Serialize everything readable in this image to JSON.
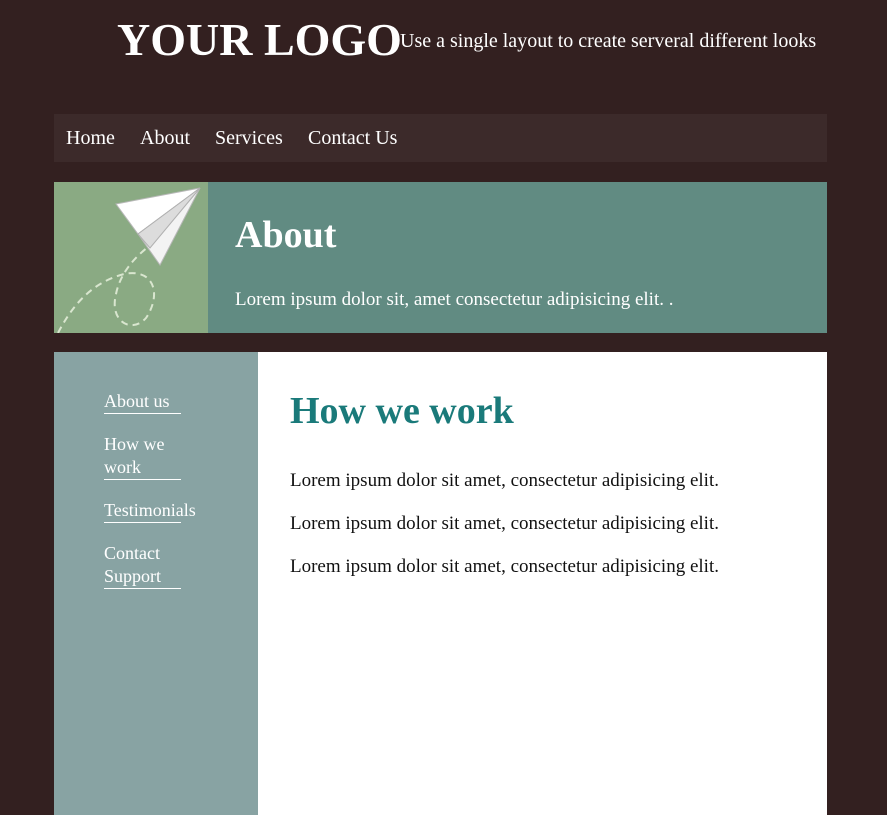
{
  "header": {
    "logo": "YOUR LOGO",
    "tagline": "Use a single layout to create serveral different looks"
  },
  "nav": {
    "items": [
      "Home",
      "About",
      "Services",
      "Contact Us"
    ]
  },
  "hero": {
    "image_icon": "paper-plane-icon",
    "title": "About",
    "text": "Lorem ipsum dolor sit, amet consectetur adipisicing elit. ."
  },
  "sidebar": {
    "links": [
      "About us",
      "How we work",
      "Testimonials",
      "Contact Support"
    ]
  },
  "main": {
    "title": "How we work",
    "paragraphs": [
      "Lorem ipsum dolor sit amet, consectetur adipisicing elit.",
      "Lorem ipsum dolor sit amet, consectetur adipisicing elit.",
      "Lorem ipsum dolor sit amet, consectetur adipisicing elit."
    ]
  },
  "colors": {
    "page_background": "#332020",
    "nav_background": "#3c2a2a",
    "hero_background": "#618b82",
    "hero_image_background": "#8aaa83",
    "sidebar_background": "#88a3a3",
    "main_title": "#1a7a7a"
  }
}
